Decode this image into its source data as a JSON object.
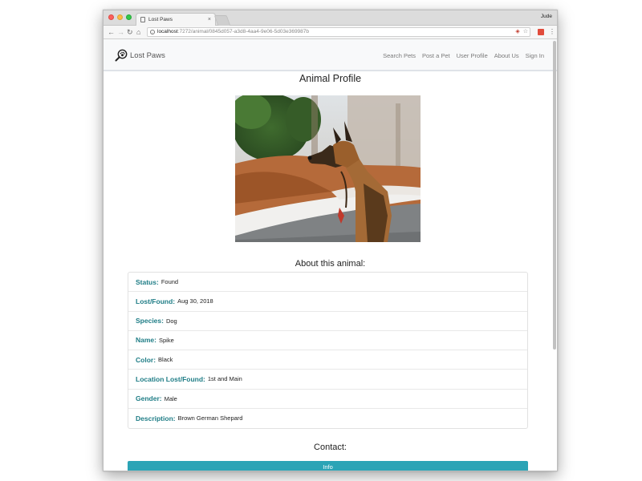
{
  "browser": {
    "tab_title": "Lost Paws",
    "tab_close": "×",
    "profile_name": "Jude",
    "url_host": "localhost",
    "url_path": ":7272/animal/0845d057-a3d8-4aa4-9e06-5d03e369987b"
  },
  "site": {
    "brand": "Lost Paws",
    "nav": {
      "search_pets": "Search Pets",
      "post_pet": "Post a Pet",
      "user_profile": "User Profile",
      "about_us": "About Us",
      "sign_in": "Sign In"
    }
  },
  "profile": {
    "title": "Animal Profile",
    "about_title": "About this animal:",
    "details": [
      {
        "label": "Status:",
        "value": "Found"
      },
      {
        "label": "Lost/Found:",
        "value": "Aug 30, 2018"
      },
      {
        "label": "Species:",
        "value": "Dog"
      },
      {
        "label": "Name:",
        "value": "Spike"
      },
      {
        "label": "Color:",
        "value": "Black"
      },
      {
        "label": "Location Lost/Found:",
        "value": "1st and Main"
      },
      {
        "label": "Gender:",
        "value": "Male"
      },
      {
        "label": "Description:",
        "value": "Brown German Shepard"
      }
    ],
    "contact_title": "Contact:",
    "info_button": "Info"
  },
  "colors": {
    "label_teal": "#1f7d86",
    "button_teal": "#2ba4b6"
  },
  "icons": {
    "brand": "magnifier-paw-icon",
    "back": "arrow-left-icon",
    "forward": "arrow-right-icon",
    "reload": "reload-icon",
    "home": "home-icon"
  }
}
